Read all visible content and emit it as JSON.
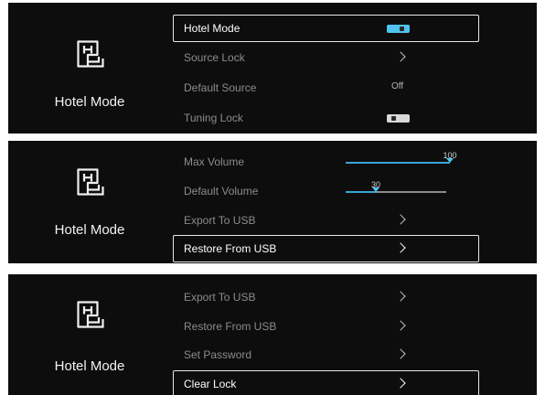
{
  "side_title": "Hotel Mode",
  "logo_icon": "hotel-mode-icon",
  "accent_color": "#4ec3f0",
  "panels": [
    {
      "rows": [
        {
          "label": "Hotel Mode",
          "type": "toggle",
          "state": "on",
          "selected": true
        },
        {
          "label": "Source Lock",
          "type": "submenu",
          "selected": false
        },
        {
          "label": "Default Source",
          "type": "value",
          "value": "Off",
          "selected": false
        },
        {
          "label": "Tuning Lock",
          "type": "toggle",
          "state": "off",
          "selected": false
        }
      ]
    },
    {
      "rows": [
        {
          "label": "Max Volume",
          "type": "slider",
          "value": "100",
          "level": 100,
          "selected": false
        },
        {
          "label": "Default Volume",
          "type": "slider",
          "value": "30",
          "level": 30,
          "selected": false
        },
        {
          "label": "Export To USB",
          "type": "submenu",
          "selected": false
        },
        {
          "label": "Restore From USB",
          "type": "submenu",
          "selected": true
        }
      ]
    },
    {
      "rows": [
        {
          "label": "Export To USB",
          "type": "submenu",
          "selected": false
        },
        {
          "label": "Restore From USB",
          "type": "submenu",
          "selected": false
        },
        {
          "label": "Set Password",
          "type": "submenu",
          "selected": false
        },
        {
          "label": "Clear Lock",
          "type": "submenu",
          "selected": true
        }
      ]
    }
  ]
}
